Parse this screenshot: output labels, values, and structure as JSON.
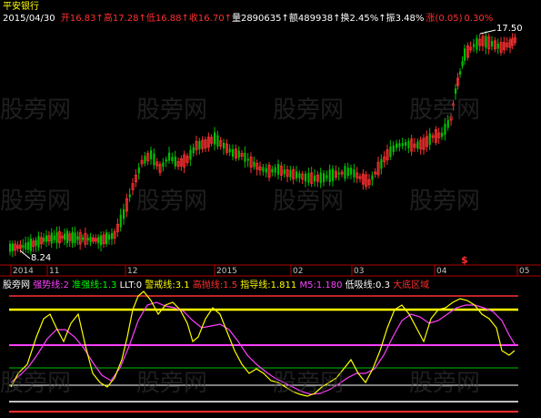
{
  "header": {
    "stock_name": "平安银行",
    "date": "2015/04/30",
    "open_label": "开",
    "open": "16.83",
    "high_label": "高",
    "high": "17.28",
    "low_label": "低",
    "low": "16.88",
    "close_label": "收",
    "close": "16.70",
    "volume_label": "量",
    "volume": "2890635",
    "amount_label": "额",
    "amount": "489938",
    "turnover_label": "换",
    "turnover": "2.45%",
    "amplitude_label": "振",
    "amplitude": "3.48%",
    "change_label": "涨",
    "change": "(0.05)",
    "change_pct": "0.30%"
  },
  "price_labels": {
    "high_mark": "17.50",
    "low_mark": "8.24",
    "dollar_mark": "$"
  },
  "watermark": "股旁网",
  "timeline": {
    "labels": [
      "2014",
      "11",
      "12",
      "2015",
      "02",
      "03",
      "04",
      "05"
    ]
  },
  "indicator": {
    "name": "股旁网",
    "items": [
      {
        "label": "强势线",
        "value": "2",
        "color": "#ff40ff"
      },
      {
        "label": "准强线",
        "value": "1.3",
        "color": "#00ff00"
      },
      {
        "label": "LLT",
        "value": "0",
        "color": "#ffffff"
      },
      {
        "label": "警戒线",
        "value": "3.1",
        "color": "#ffff00"
      },
      {
        "label": "高抛线",
        "value": "1.5",
        "color": "#ff3030"
      },
      {
        "label": "指导线",
        "value": "1.811",
        "color": "#ffff00"
      },
      {
        "label": "M5",
        "value": "1.180",
        "color": "#ff40ff"
      },
      {
        "label": "低吸线",
        "value": "0.3",
        "color": "#ffffff"
      },
      {
        "label": "大底区域",
        "value": "",
        "color": "#ff3030"
      }
    ]
  },
  "colors": {
    "up": "#ff3030",
    "down": "#00e0e0",
    "green_candle": "#00c000",
    "yellow": "#ffff00",
    "magenta": "#ff40ff",
    "grid": "#b00000"
  }
}
